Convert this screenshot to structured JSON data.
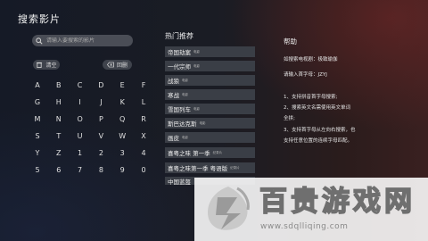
{
  "header": {
    "title": "搜索影片"
  },
  "search": {
    "placeholder": "请输入要搜索的影片"
  },
  "buttons": {
    "clear": "清空",
    "backspace": "回删"
  },
  "keyboard": {
    "keys": [
      "A",
      "B",
      "C",
      "D",
      "E",
      "F",
      "G",
      "H",
      "I",
      "J",
      "K",
      "L",
      "M",
      "N",
      "O",
      "P",
      "Q",
      "R",
      "S",
      "T",
      "U",
      "V",
      "W",
      "X",
      "Y",
      "Z",
      "1",
      "2",
      "3",
      "4",
      "5",
      "6",
      "7",
      "8",
      "9",
      "0"
    ]
  },
  "hot": {
    "title": "热门推荐",
    "items": [
      {
        "name": "帝国劫案",
        "tag": "电影"
      },
      {
        "name": "一代宗师",
        "tag": "电影"
      },
      {
        "name": "战狼",
        "tag": "电影"
      },
      {
        "name": "寒战",
        "tag": "电影"
      },
      {
        "name": "雪国列车",
        "tag": "电影"
      },
      {
        "name": "斯巴达克斯",
        "tag": "电影"
      },
      {
        "name": "画皮",
        "tag": "电影"
      },
      {
        "name": "喜粤之味 第一季",
        "tag": "纪录片"
      },
      {
        "name": "喜粤之味第一季 粤语版",
        "tag": "纪录片"
      },
      {
        "name": "中国蓝盔",
        "tag": ""
      }
    ]
  },
  "help": {
    "title": "帮助",
    "example_line1": "如搜索电视剧：极致瑜伽",
    "example_line2": "请输入首字母：JZYJ",
    "tips": [
      "1、支持拼音首字母搜索;",
      "2、搜索英文名需使用英文单词",
      "全拼;",
      "3、支持首字母从左向右搜索，也",
      "支持任意位置的连续字母匹配。"
    ]
  },
  "watermark": {
    "text": "百贵游戏网",
    "url": "www.sdqlliqing.com"
  }
}
